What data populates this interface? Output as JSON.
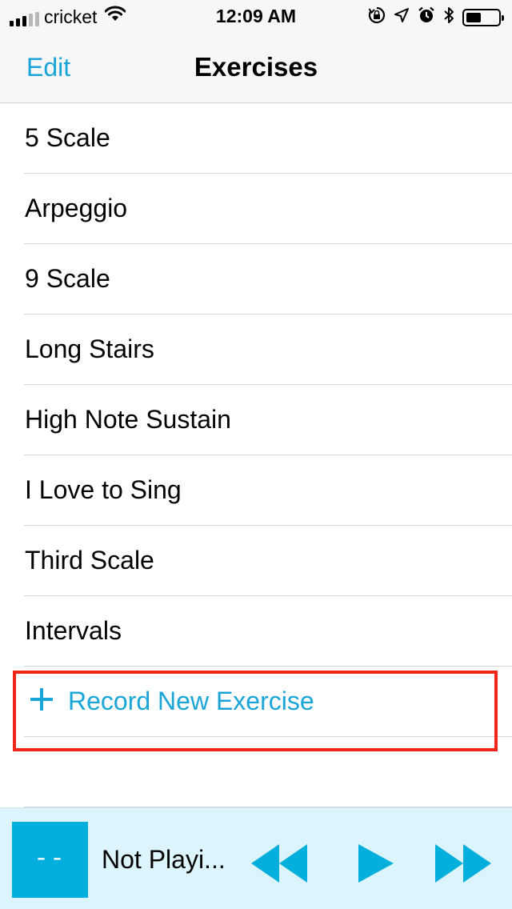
{
  "status_bar": {
    "carrier": "cricket",
    "time": "12:09 AM",
    "icons": [
      "signal-icon",
      "wifi-icon",
      "orientation-lock-icon",
      "location-icon",
      "alarm-icon",
      "bluetooth-icon",
      "battery-icon"
    ]
  },
  "nav": {
    "edit_label": "Edit",
    "title": "Exercises"
  },
  "exercises": [
    "5 Scale",
    "Arpeggio",
    "9 Scale",
    "Long Stairs",
    "High Note Sustain",
    "I Love to Sing",
    "Third Scale",
    "Intervals"
  ],
  "record": {
    "label": "Record New Exercise",
    "icon": "plus-icon"
  },
  "player": {
    "art_text": "--",
    "title": "Not Playi...",
    "controls": [
      "rewind-icon",
      "play-icon",
      "fast-forward-icon"
    ]
  },
  "colors": {
    "accent": "#1aa5d8",
    "player_background": "#dcf4fb",
    "player_art": "#04aedd",
    "highlight": "#f0261b"
  }
}
